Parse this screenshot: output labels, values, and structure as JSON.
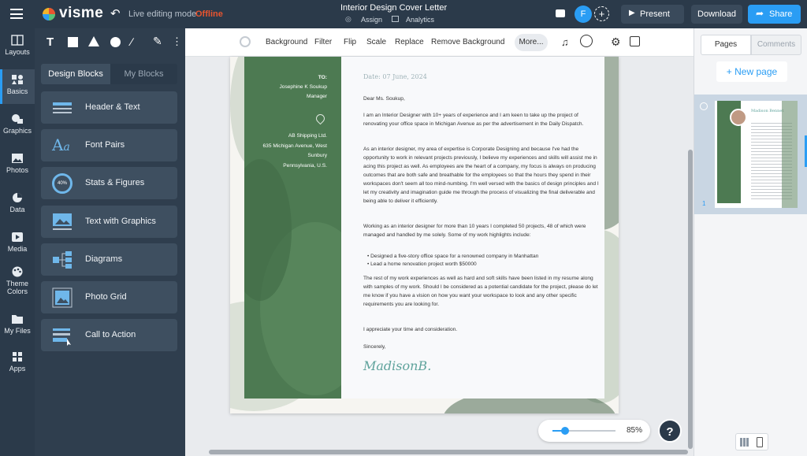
{
  "app": {
    "brand": "visme",
    "mode_label": "Live editing mode",
    "mode_status": "Offline",
    "doc_title": "Interior Design Cover Letter",
    "assign_label": "Assign",
    "analytics_label": "Analytics",
    "avatar_initial": "F",
    "present_label": "Present",
    "download_label": "Download",
    "share_label": "Share"
  },
  "rail": [
    "Layouts",
    "Basics",
    "Graphics",
    "Photos",
    "Data",
    "Media",
    "Theme Colors",
    "My Files",
    "Apps"
  ],
  "panel": {
    "tab_design": "Design Blocks",
    "tab_my": "My Blocks",
    "blocks": [
      "Header & Text",
      "Font Pairs",
      "Stats & Figures",
      "Text with Graphics",
      "Diagrams",
      "Photo Grid",
      "Call to Action"
    ],
    "stats_icon_text": "40%"
  },
  "toolbar": {
    "background": "Background",
    "filter": "Filter",
    "flip": "Flip",
    "scale": "Scale",
    "replace": "Replace",
    "remove_bg": "Remove Background",
    "more": "More..."
  },
  "letter": {
    "to_label": "TO:",
    "to_name": "Josephine K Soukup",
    "to_title": "Manager",
    "addr1": "AB Shipping Ltd.",
    "addr2": "635 Michigan Avenue, West",
    "addr3": "Sunbury",
    "addr4": "Pennsylvania, U.S.",
    "date": "Date: 07 June, 2024",
    "salutation": "Dear Ms. Soukup,",
    "p1": "I am an Interior Designer with 10+ years of experience and I am keen to take up the project of renovating your office space in Michigan Avenue as per the advertisement in the Daily Dispatch.",
    "p2": "As an interior designer, my area of expertise is Corporate Designing and because I've had the opportunity to work in relevant projects previously, I believe my experiences and skills will assist me in acing this project as well. As employees are the heart of a company, my focus is always on producing outcomes that are both safe and breathable for the employees so that the hours they spend in their workspaces don't seem all too mind-numbing. I'm well versed with the basics of design principles and I let my creativity and imagination guide me through the process of visualizing the final deliverable and being able to deliver it efficiently.",
    "p3": "Working as an interior designer for more than 10 years I completed 50 projects, 48 of which were managed and handled by me solely. Some of my work highlights include:",
    "b1": "Designed a five-story office space for a renowned company in Manhattan",
    "b2": "Lead a home renovation project worth $50000",
    "p4": "The rest of my work experiences as well as hard and soft skills have been listed in my resume along with samples of my work. Should I be considered as a potential candidate for the project, please do let me know if you have a vision on how you want your workspace to look and any other specific requirements you are looking for.",
    "p5": "I appreciate your time and consideration.",
    "closing": "Sincerely,",
    "signature": "MadisonB."
  },
  "zoom": {
    "level": "85%",
    "fraction": 0.2
  },
  "help": "?",
  "right": {
    "tab_pages": "Pages",
    "tab_comments": "Comments",
    "new_page": "+ New page",
    "page_number": "1",
    "thumb_name": "Madison Bennet"
  },
  "colors": {
    "accent": "#2a9df4",
    "offline": "#e8542f",
    "green": "#4d7a52",
    "dark": "#2b3a4a"
  }
}
